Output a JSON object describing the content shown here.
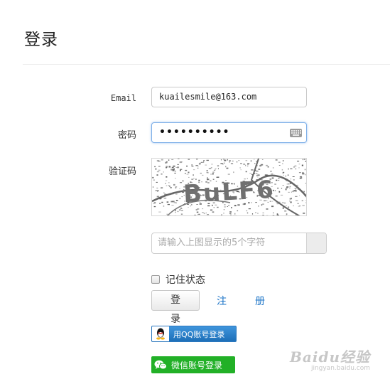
{
  "page": {
    "title": "登录"
  },
  "form": {
    "email_label": "Email",
    "email_value": "kuailesmile@163.com",
    "password_label": "密码",
    "password_mask": "••••••••••",
    "captcha_label": "验证码",
    "captcha_text": "BuLF6",
    "code_placeholder": "请输入上图显示的5个字符",
    "remember_label": "记住状态",
    "login_button": "登　录",
    "register_link": "注　册"
  },
  "social": {
    "qq_label": "用QQ账号登录",
    "wechat_label": "微信账号登录"
  },
  "watermark": {
    "brand": "Baidu经验",
    "domain": "jingyan.baidu.com"
  },
  "colors": {
    "link": "#1a73c7",
    "qq_blue": "#1d6fb8",
    "wechat_green": "#22b027",
    "focus_border": "#7fb0e8"
  },
  "icons": [
    "keyboard-icon",
    "qq-penguin-icon",
    "wechat-icon"
  ]
}
